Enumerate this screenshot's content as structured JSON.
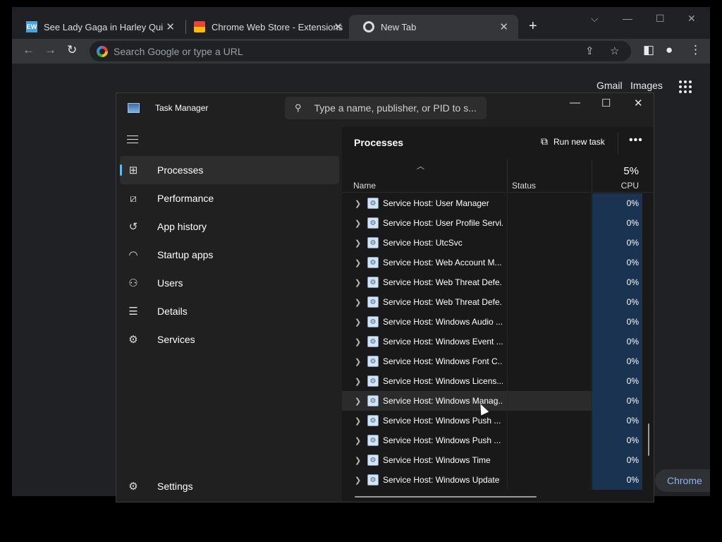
{
  "browser": {
    "tabs": [
      {
        "title": "See Lady Gaga in Harley Quinn m",
        "favicon": "EW",
        "active": false
      },
      {
        "title": "Chrome Web Store - Extensions",
        "favicon": "chrome-web-store-icon",
        "active": false
      },
      {
        "title": "New Tab",
        "favicon": "chrome-icon",
        "active": true
      }
    ],
    "omnibox_placeholder": "Search Google or type a URL",
    "ntp_links": {
      "gmail": "Gmail",
      "images": "Images"
    },
    "customize_label": "Chrome"
  },
  "task_manager": {
    "title": "Task Manager",
    "search_placeholder": "Type a name, publisher, or PID to s...",
    "nav": [
      {
        "label": "Processes",
        "icon": "processes-icon",
        "active": true
      },
      {
        "label": "Performance",
        "icon": "performance-icon",
        "active": false
      },
      {
        "label": "App history",
        "icon": "history-icon",
        "active": false
      },
      {
        "label": "Startup apps",
        "icon": "startup-icon",
        "active": false
      },
      {
        "label": "Users",
        "icon": "users-icon",
        "active": false
      },
      {
        "label": "Details",
        "icon": "details-icon",
        "active": false
      },
      {
        "label": "Services",
        "icon": "services-icon",
        "active": false
      }
    ],
    "settings_label": "Settings",
    "page_title": "Processes",
    "run_new_task": "Run new task",
    "columns": {
      "name": "Name",
      "status": "Status",
      "cpu_total": "5%",
      "cpu": "CPU"
    },
    "rows": [
      {
        "name": "Service Host: User Manager",
        "status": "",
        "cpu": "0%"
      },
      {
        "name": "Service Host: User Profile Servi...",
        "status": "",
        "cpu": "0%"
      },
      {
        "name": "Service Host: UtcSvc",
        "status": "",
        "cpu": "0%"
      },
      {
        "name": "Service Host: Web Account M...",
        "status": "",
        "cpu": "0%"
      },
      {
        "name": "Service Host: Web Threat Defe...",
        "status": "",
        "cpu": "0%"
      },
      {
        "name": "Service Host: Web Threat Defe...",
        "status": "",
        "cpu": "0%"
      },
      {
        "name": "Service Host: Windows Audio ...",
        "status": "",
        "cpu": "0%"
      },
      {
        "name": "Service Host: Windows Event ...",
        "status": "",
        "cpu": "0%"
      },
      {
        "name": "Service Host: Windows Font C...",
        "status": "",
        "cpu": "0%"
      },
      {
        "name": "Service Host: Windows Licens...",
        "status": "",
        "cpu": "0%"
      },
      {
        "name": "Service Host: Windows Manag...",
        "status": "",
        "cpu": "0%"
      },
      {
        "name": "Service Host: Windows Push ...",
        "status": "",
        "cpu": "0%"
      },
      {
        "name": "Service Host: Windows Push ...",
        "status": "",
        "cpu": "0%"
      },
      {
        "name": "Service Host: Windows Time",
        "status": "",
        "cpu": "0%"
      },
      {
        "name": "Service Host: Windows Update",
        "status": "",
        "cpu": "0%"
      }
    ]
  },
  "colors": {
    "accent": "#4cc2ff",
    "cpu_column": "#1a3350",
    "chrome_bg": "#202124",
    "link": "#8ab4f8"
  }
}
